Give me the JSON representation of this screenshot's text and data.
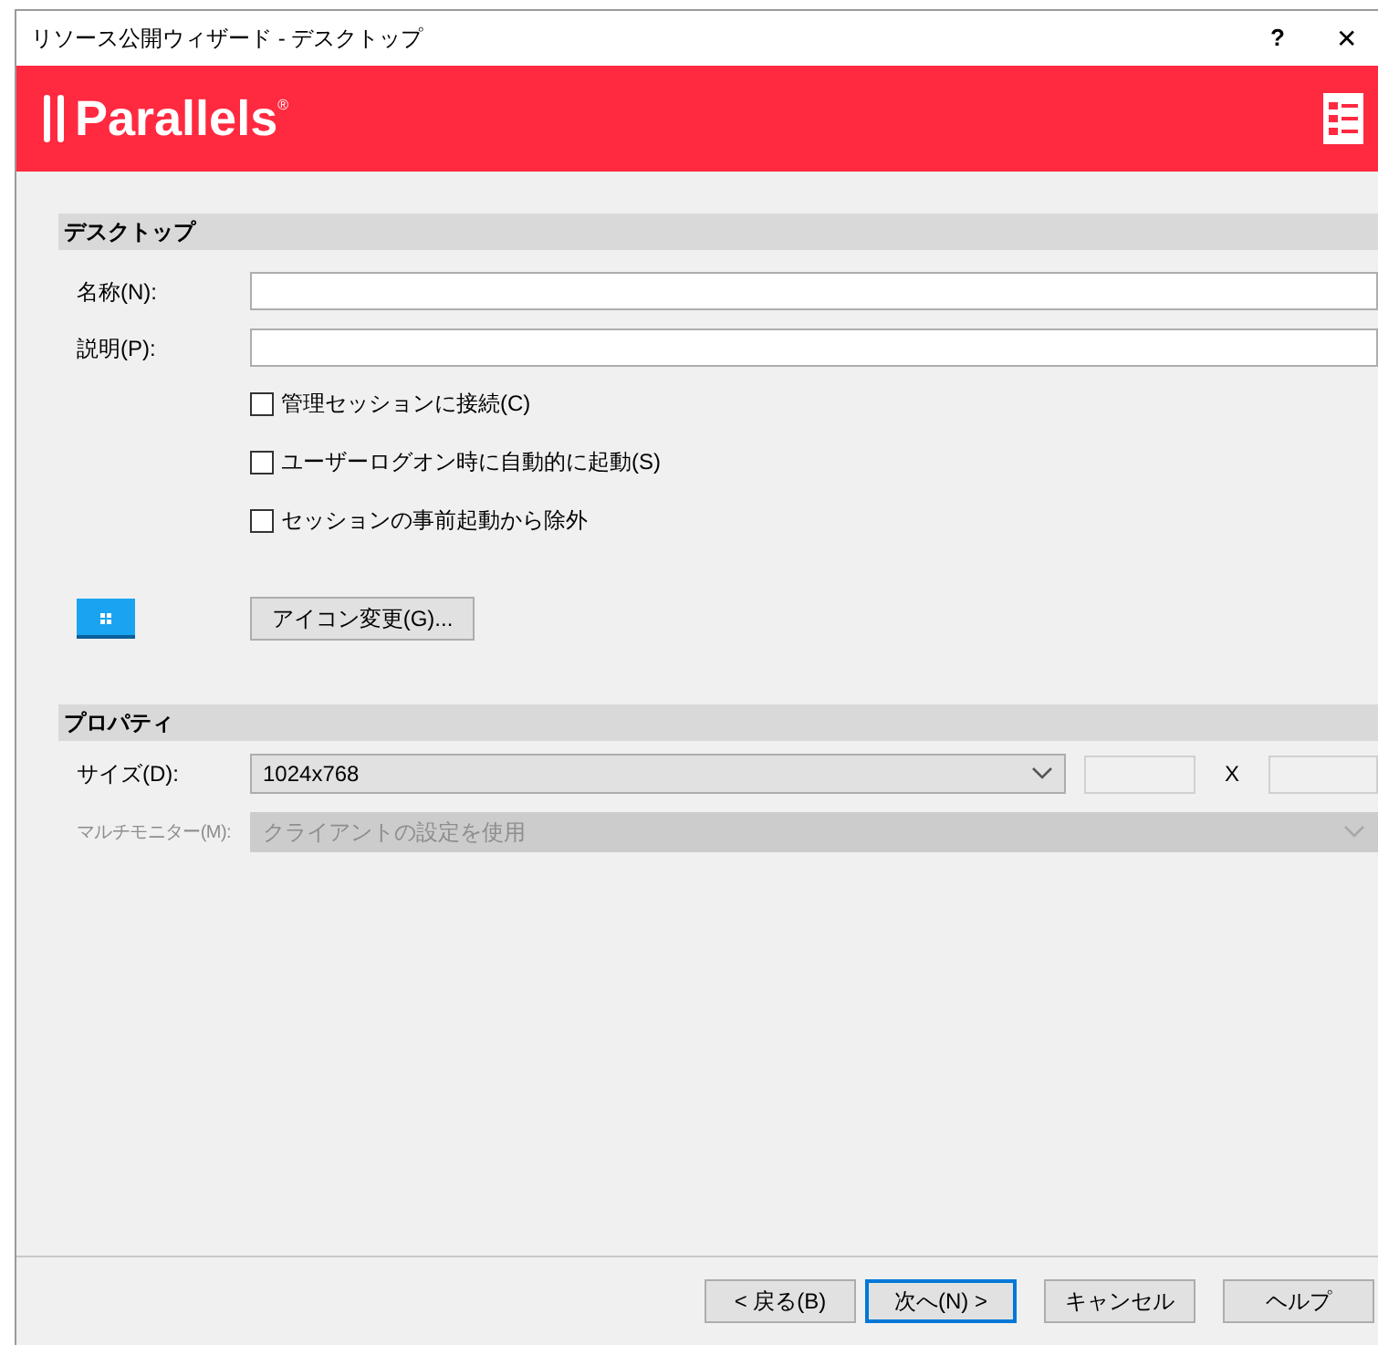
{
  "window": {
    "title": "リソース公開ウィザード - デスクトップ",
    "help": "?",
    "close": "✕"
  },
  "banner": {
    "logo": "Parallels",
    "mark": "®"
  },
  "desktop_section": {
    "title": "デスクトップ",
    "fields": [
      {
        "label": "名称(N):"
      },
      {
        "label": "説明(P):"
      }
    ],
    "checkboxes": [
      {
        "label": "管理セッションに接続(C)",
        "checked": false
      },
      {
        "label": "ユーザーログオン時に自動的に起動(S)",
        "checked": false
      },
      {
        "label": "セッションの事前起動から除外",
        "checked": false
      }
    ],
    "icon_button": "アイコン変更(G)..."
  },
  "properties_section": {
    "title": "プロパティ",
    "size": {
      "label": "サイズ(D):",
      "value": "1024x768",
      "disabled": false,
      "separator": "X"
    },
    "multi_monitor": {
      "label": "マルチモニター(M):",
      "value": "クライアントの設定を使用",
      "disabled": true
    }
  },
  "buttons": [
    {
      "label": "< 戻る(B)",
      "default": false
    },
    {
      "label": "次へ(N) >",
      "default": true
    },
    {
      "label": "キャンセル",
      "default": false
    },
    {
      "label": "ヘルプ",
      "default": false
    }
  ]
}
